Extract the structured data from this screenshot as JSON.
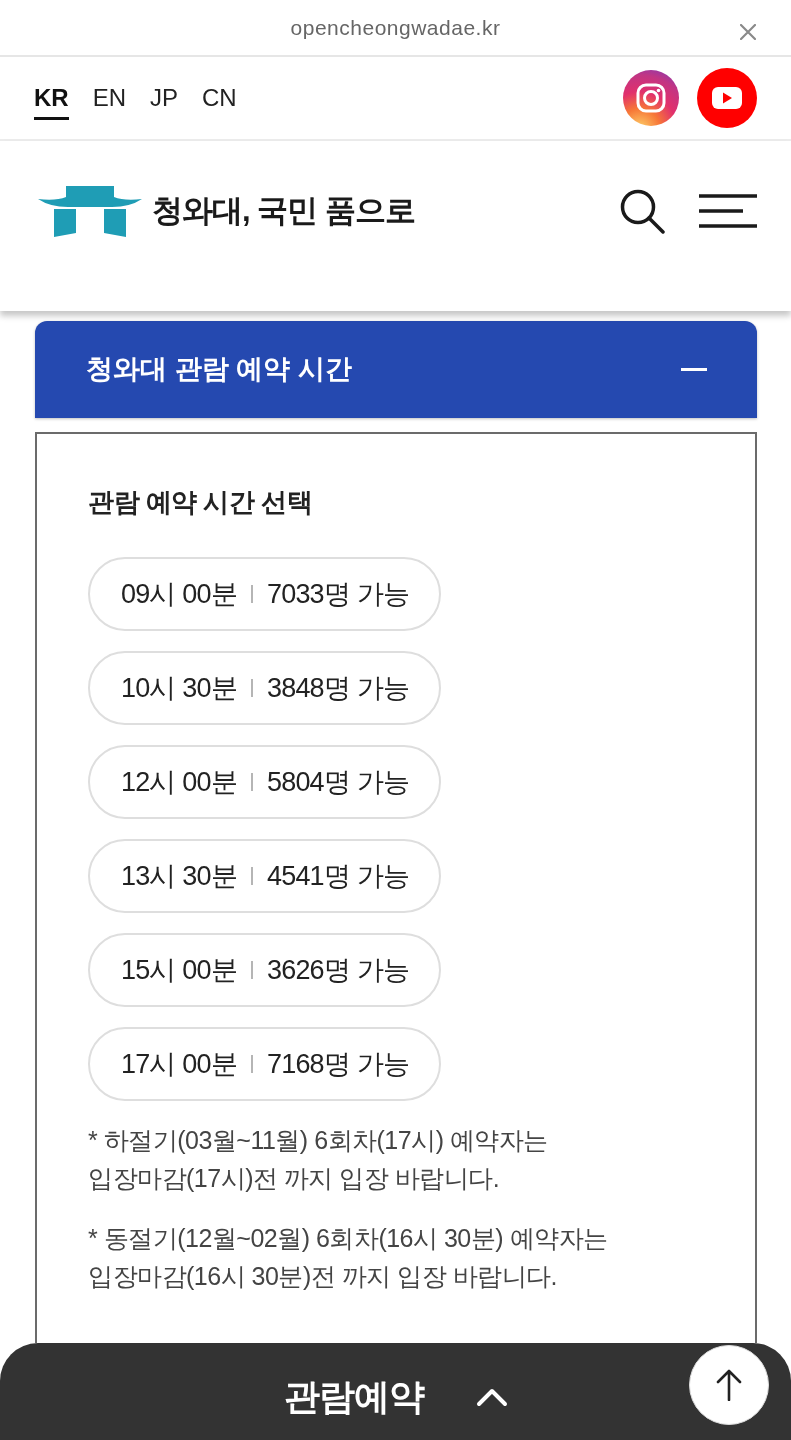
{
  "browser": {
    "url": "opencheongwadae.kr"
  },
  "languages": [
    {
      "label": "KR",
      "selected": true
    },
    {
      "label": "EN",
      "selected": false
    },
    {
      "label": "JP",
      "selected": false
    },
    {
      "label": "CN",
      "selected": false
    }
  ],
  "header": {
    "title": "청와대, 국민 품으로"
  },
  "accordion": {
    "title": "청와대 관람 예약 시간",
    "expanded": true,
    "heading": "관람 예약 시간 선택",
    "slots": [
      {
        "time": "09시 00분",
        "availability": "7033명 가능"
      },
      {
        "time": "10시 30분",
        "availability": "3848명 가능"
      },
      {
        "time": "12시 00분",
        "availability": "5804명 가능"
      },
      {
        "time": "13시 30분",
        "availability": "4541명 가능"
      },
      {
        "time": "15시 00분",
        "availability": "3626명 가능"
      },
      {
        "time": "17시 00분",
        "availability": "7168명 가능"
      }
    ],
    "notes": [
      "* 하절기(03월~11월) 6회차(17시) 예약자는 입장마감(17시)전 까지 입장 바랍니다.",
      "* 동절기(12월~02월) 6회차(16시 30분) 예약자는 입장마감(16시 30분)전 까지 입장 바랍니다."
    ]
  },
  "bottom_bar": {
    "label": "관람예약"
  }
}
